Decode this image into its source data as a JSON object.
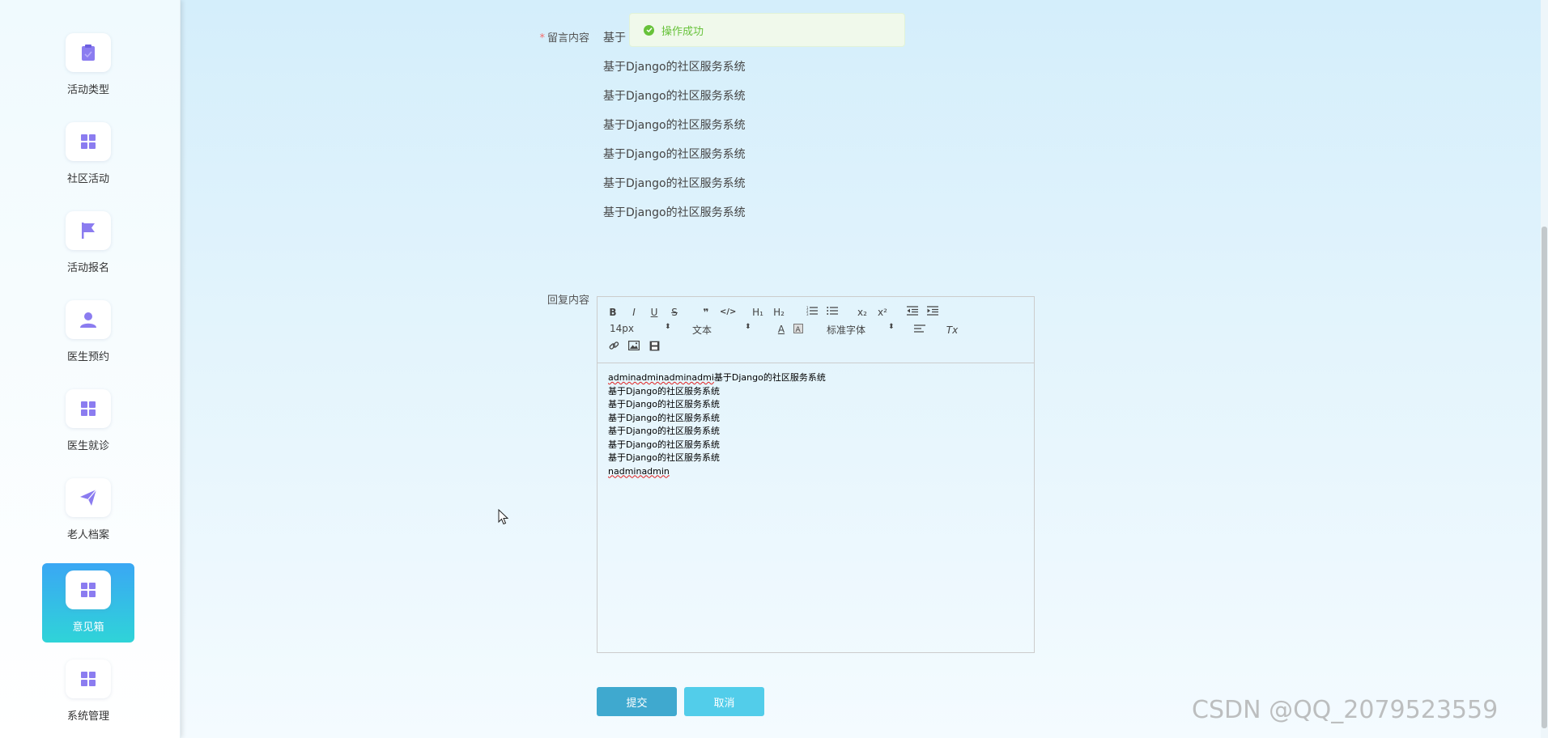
{
  "sidebar": {
    "items": [
      {
        "label": "活动类型",
        "icon": "clipboard-icon",
        "active": false
      },
      {
        "label": "社区活动",
        "icon": "grid-icon",
        "active": false
      },
      {
        "label": "活动报名",
        "icon": "flag-icon",
        "active": false
      },
      {
        "label": "医生预约",
        "icon": "user-icon",
        "active": false
      },
      {
        "label": "医生就诊",
        "icon": "grid-icon",
        "active": false
      },
      {
        "label": "老人档案",
        "icon": "paper-plane-icon",
        "active": false
      },
      {
        "label": "意见箱",
        "icon": "grid-icon",
        "active": true
      },
      {
        "label": "系统管理",
        "icon": "grid-icon",
        "active": false
      }
    ]
  },
  "toast": {
    "message": "操作成功",
    "type": "success",
    "color": "#67c23a"
  },
  "form": {
    "message_label": "留言内容",
    "required_mark": "*",
    "message_lines": [
      "基于",
      "基于Django的社区服务系统",
      "基于Django的社区服务系统",
      "基于Django的社区服务系统",
      "基于Django的社区服务系统",
      "基于Django的社区服务系统",
      "基于Django的社区服务系统"
    ],
    "reply_label": "回复内容"
  },
  "editor": {
    "font_size": "14px",
    "header_select": "文本",
    "font_select": "标准字体",
    "toolbar_buttons": {
      "bold": "B",
      "italic": "I",
      "underline": "U",
      "strike": "S",
      "quote": "❞",
      "code": "</>",
      "h1": "H₁",
      "h2": "H₂",
      "sub": "x₂",
      "sup": "x²",
      "color": "A",
      "clean": "Tx"
    },
    "content": {
      "line1_spell": "adminadminadminadmi",
      "line1_rest": "基于Django的社区服务系统",
      "lines": [
        "基于Django的社区服务系统",
        "基于Django的社区服务系统",
        "基于Django的社区服务系统",
        "基于Django的社区服务系统",
        "基于Django的社区服务系统",
        "基于Django的社区服务系统"
      ],
      "last_line": "nadminadmin"
    }
  },
  "buttons": {
    "submit": "提交",
    "cancel": "取消"
  },
  "watermark": "CSDN @QQ_2079523559",
  "colors": {
    "active_gradient_start": "#3aa7f4",
    "active_gradient_end": "#2fd4d8",
    "icon_color": "#8b7cf0",
    "submit": "#3fa9cf",
    "cancel": "#52cdea"
  }
}
